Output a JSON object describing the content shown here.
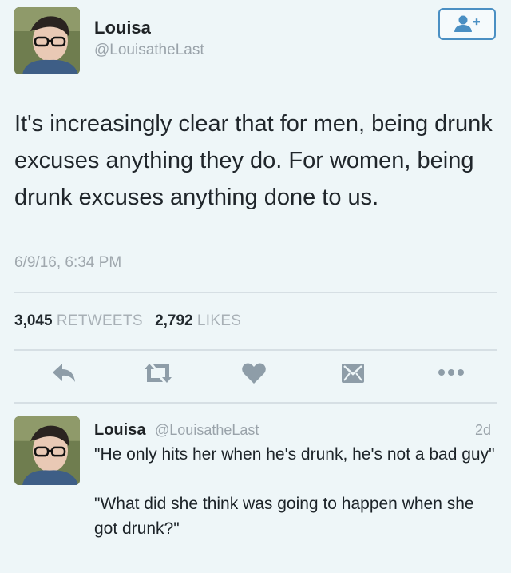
{
  "tweet": {
    "author_name": "Louisa",
    "author_handle": "@LouisatheLast",
    "text": "It's increasingly clear that for men, being drunk excuses anything they do. For women, being drunk excuses anything done to us.",
    "timestamp": "6/9/16, 6:34 PM",
    "retweet_count": "3,045",
    "retweet_label": "RETWEETS",
    "like_count": "2,792",
    "like_label": "LIKES",
    "actions": [
      "reply-icon",
      "retweet-icon",
      "heart-icon",
      "message-icon",
      "more-icon"
    ],
    "follow_icon": "add-user-icon"
  },
  "reply": {
    "author_name": "Louisa",
    "author_handle": "@LouisatheLast",
    "age": "2d",
    "text": "\"He only hits her when he's drunk, he's not a bad guy\"\n\n\"What did she think was going to happen when she got drunk?\""
  },
  "colors": {
    "background": "#eef6f8",
    "accent": "#4a8fc3",
    "icon": "#8e9da8",
    "muted_text": "#9aa3aa"
  }
}
